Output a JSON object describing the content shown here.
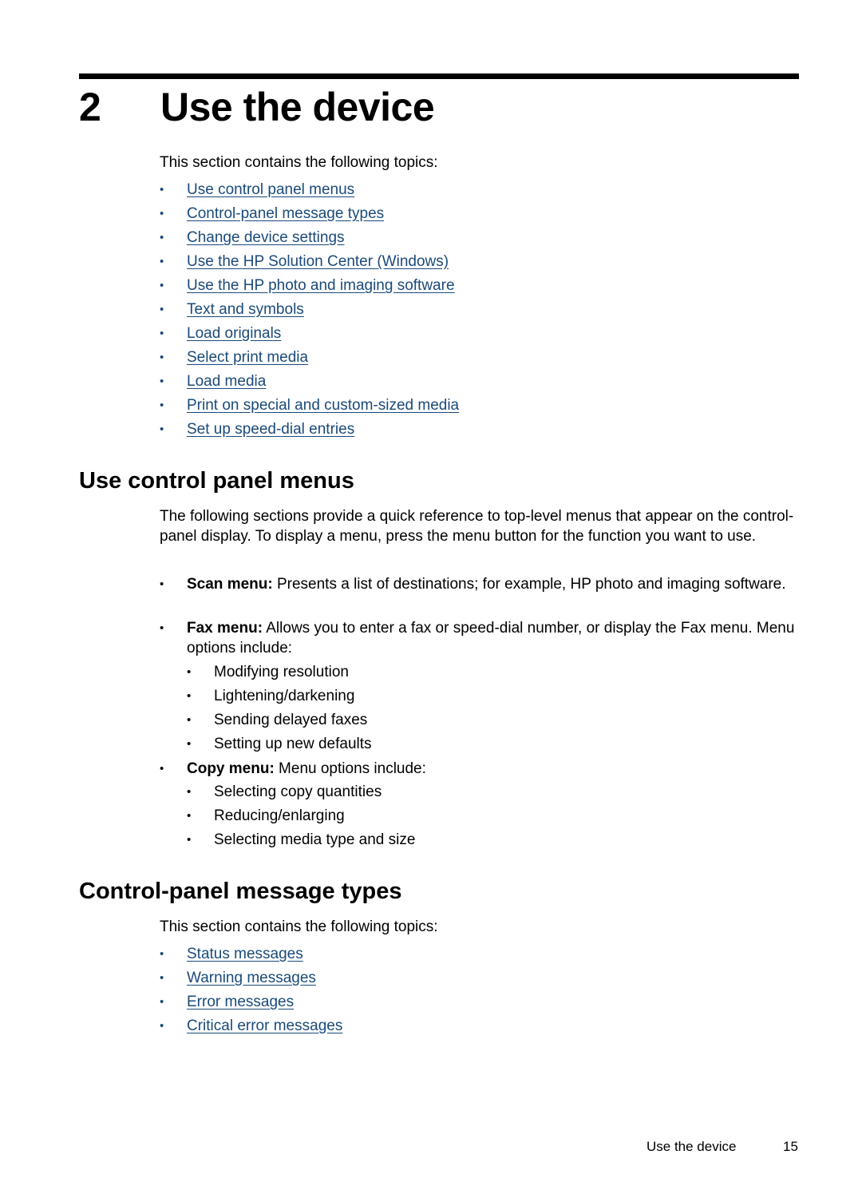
{
  "chapter": {
    "number": "2",
    "title": "Use the device"
  },
  "intro": {
    "text": "This section contains the following topics:",
    "links": [
      "Use control panel menus",
      "Control-panel message types",
      "Change device settings",
      "Use the HP Solution Center (Windows)",
      "Use the HP photo and imaging software",
      "Text and symbols",
      "Load originals",
      "Select print media",
      "Load media",
      "Print on special and custom-sized media",
      "Set up speed-dial entries"
    ]
  },
  "section1": {
    "heading": "Use control panel menus",
    "paragraph": "The following sections provide a quick reference to top-level menus that appear on the control-panel display. To display a menu, press the menu button for the function you want to use.",
    "items": [
      {
        "label": "Scan menu:",
        "text": " Presents a list of destinations; for example, HP photo and imaging software."
      },
      {
        "label": "Fax menu:",
        "text": " Allows you to enter a fax or speed-dial number, or display the Fax menu. Menu options include:",
        "sub": [
          "Modifying resolution",
          "Lightening/darkening",
          "Sending delayed faxes",
          "Setting up new defaults"
        ]
      },
      {
        "label": "Copy menu:",
        "text": " Menu options include:",
        "sub": [
          "Selecting copy quantities",
          "Reducing/enlarging",
          "Selecting media type and size"
        ]
      }
    ]
  },
  "section2": {
    "heading": "Control-panel message types",
    "text": "This section contains the following topics:",
    "links": [
      "Status messages",
      "Warning messages",
      "Error messages",
      "Critical error messages"
    ]
  },
  "footer": {
    "title": "Use the device",
    "page": "15"
  },
  "colors": {
    "link": "#1a4a7a",
    "text": "#000000"
  }
}
